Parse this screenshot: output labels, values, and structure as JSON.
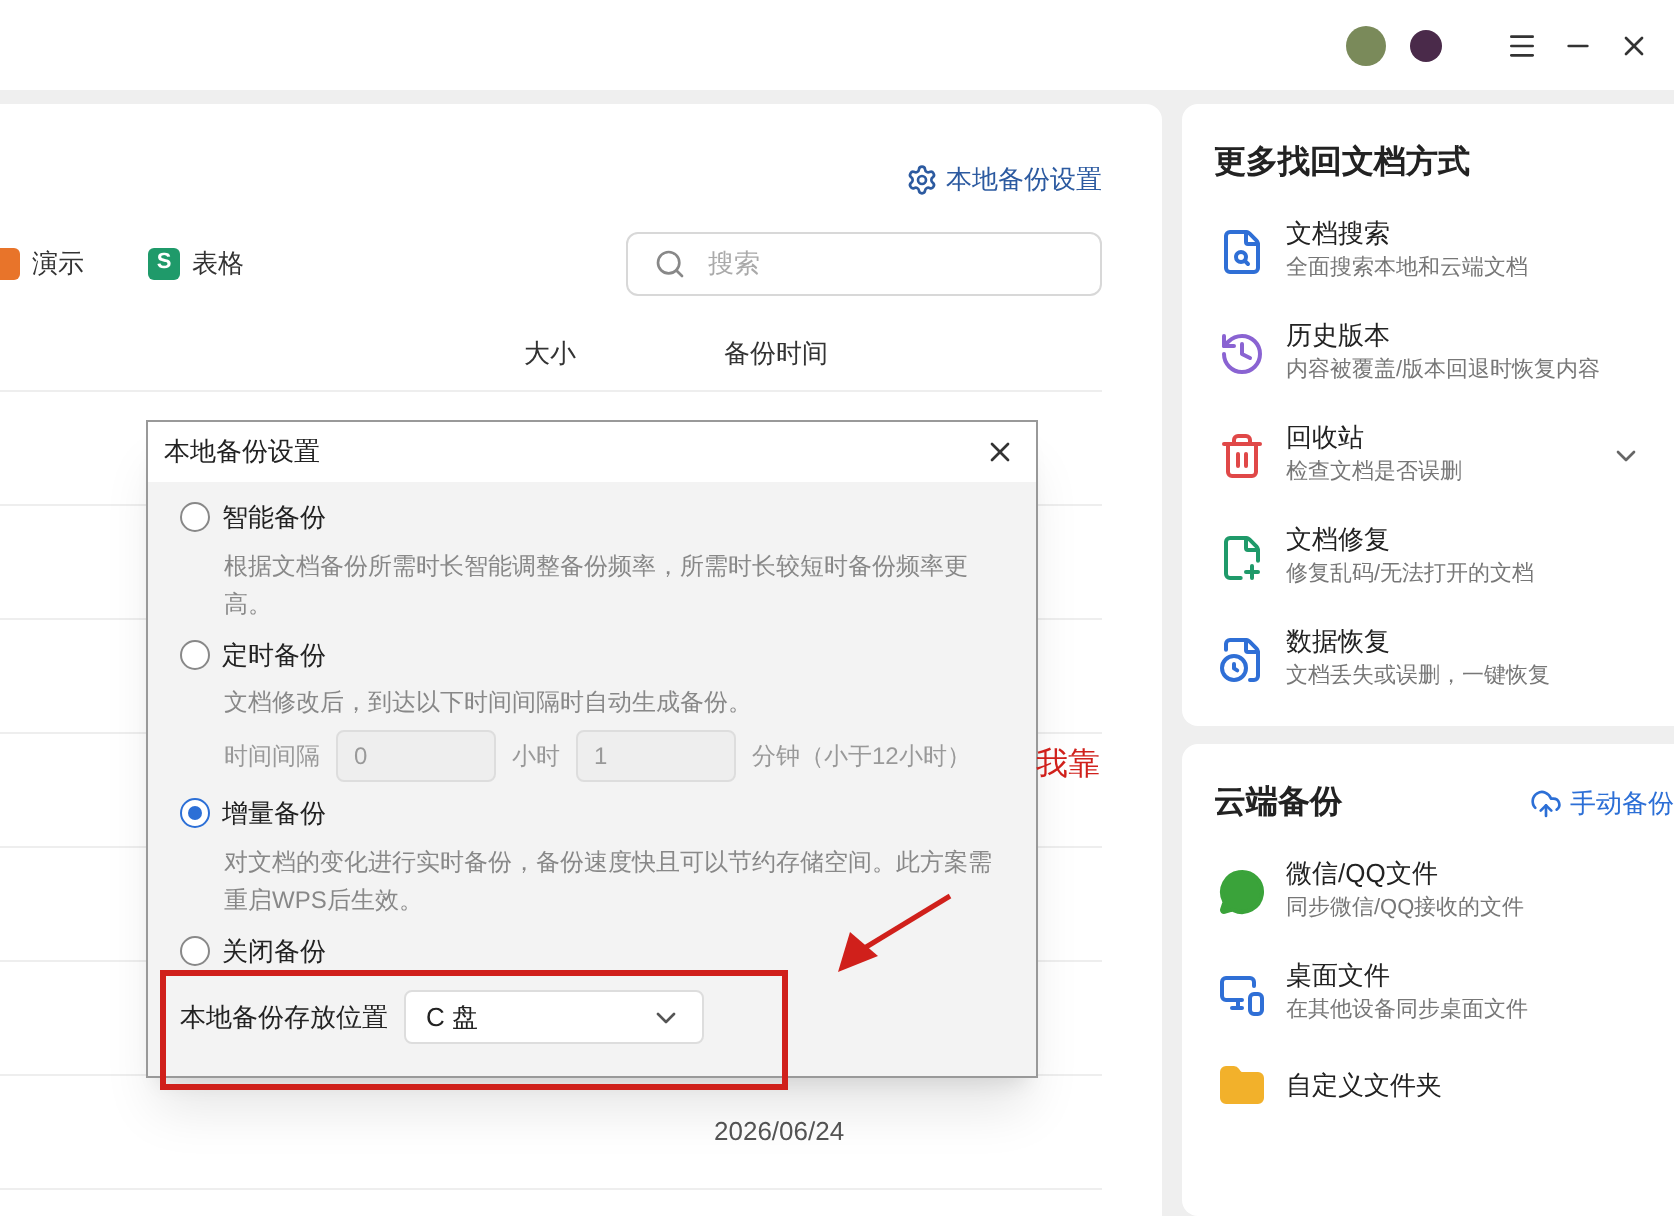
{
  "main": {
    "settings_link": "本地备份设置",
    "filters": [
      {
        "label": "演示",
        "color": "#e8742a"
      },
      {
        "label": "表格",
        "icon_letter": "S",
        "color": "#1f9a6a"
      }
    ],
    "search": {
      "placeholder": "搜索"
    },
    "table": {
      "columns": [
        "大小",
        "备份时间"
      ],
      "rows": [
        {
          "backup_time": "2026/06/24"
        }
      ]
    }
  },
  "dialog": {
    "title": "本地备份设置",
    "options": [
      {
        "label": "智能备份",
        "selected": false,
        "description": "根据文档备份所需时长智能调整备份频率，所需时长较短时备份频率更高。"
      },
      {
        "label": "定时备份",
        "selected": false,
        "description": "文档修改后，到达以下时间间隔时自动生成备份。",
        "interval": {
          "label": "时间间隔",
          "hours": "0",
          "hours_unit": "小时",
          "minutes": "1",
          "minutes_unit": "分钟（小于12小时）"
        }
      },
      {
        "label": "增量备份",
        "selected": true,
        "description": "对文档的变化进行实时备份，备份速度快且可以节约存储空间。此方案需重启WPS后生效。"
      },
      {
        "label": "关闭备份",
        "selected": false
      }
    ],
    "location": {
      "label": "本地备份存放位置",
      "value": "C 盘"
    }
  },
  "annotation": {
    "text": "我靠"
  },
  "recovery_panel": {
    "title": "更多找回文档方式",
    "items": [
      {
        "kind": "search",
        "title": "文档搜索",
        "subtitle": "全面搜索本地和云端文档"
      },
      {
        "kind": "history",
        "title": "历史版本",
        "subtitle": "内容被覆盖/版本回退时恢复内容"
      },
      {
        "kind": "trash",
        "title": "回收站",
        "subtitle": "检查文档是否误删",
        "expandable": true
      },
      {
        "kind": "repair",
        "title": "文档修复",
        "subtitle": "修复乱码/无法打开的文档"
      },
      {
        "kind": "restore",
        "title": "数据恢复",
        "subtitle": "文档丢失或误删，一键恢复"
      }
    ]
  },
  "cloud_panel": {
    "title": "云端备份",
    "action": "手动备份",
    "items": [
      {
        "kind": "chat",
        "title": "微信/QQ文件",
        "subtitle": "同步微信/QQ接收的文件"
      },
      {
        "kind": "desktop",
        "title": "桌面文件",
        "subtitle": "在其他设备同步桌面文件"
      },
      {
        "kind": "folder",
        "title": "自定义文件夹"
      }
    ]
  }
}
